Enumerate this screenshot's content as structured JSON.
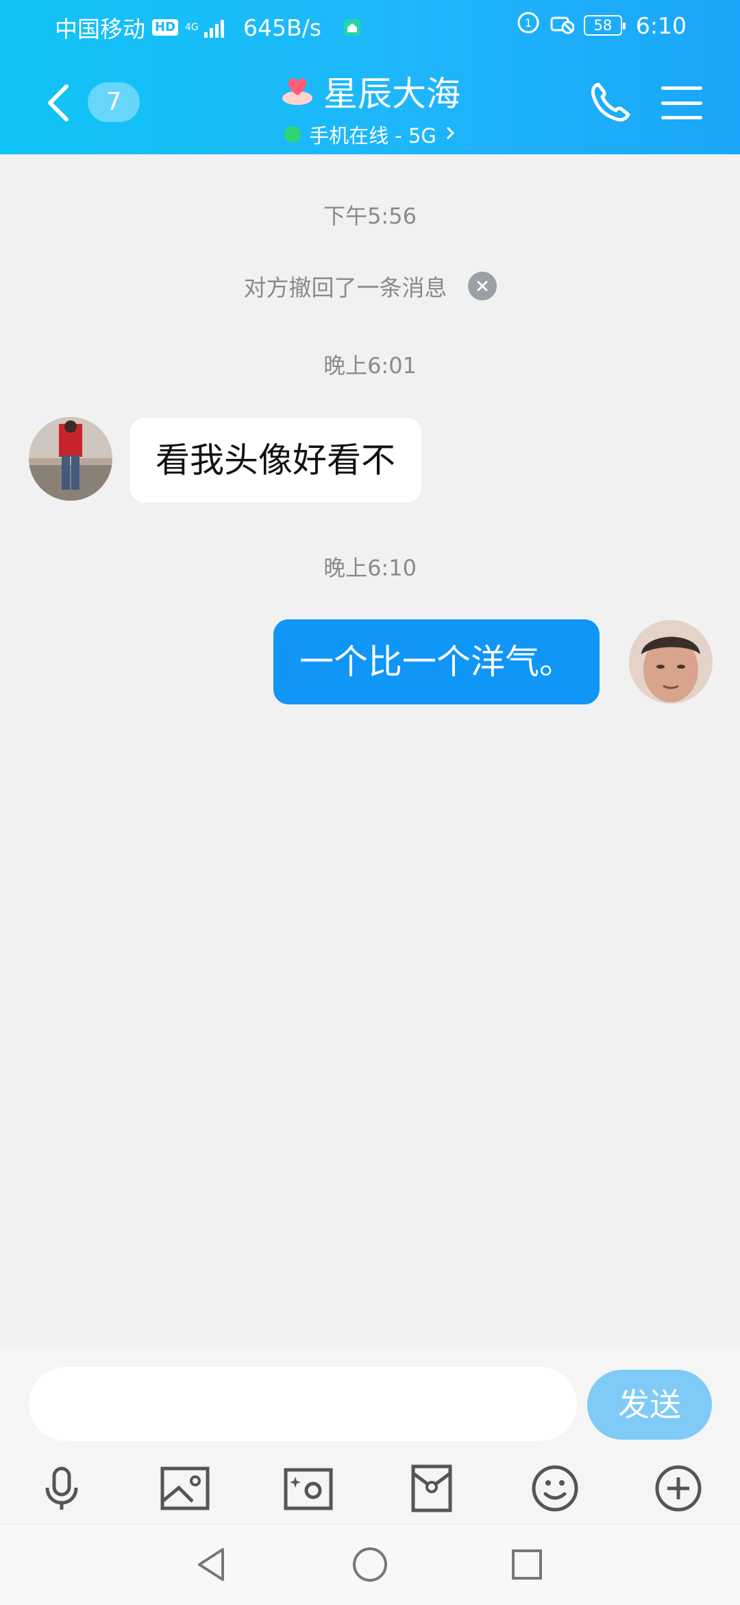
{
  "status_bar": {
    "carrier": "中国移动",
    "hd": "HD",
    "network": "4G",
    "net_speed": "645B/s",
    "battery": "58",
    "time": "6:10"
  },
  "header": {
    "unread_count": "7",
    "title": "星辰大海",
    "subtitle": "手机在线 - 5G",
    "accent": "#1fb6fb"
  },
  "chat": {
    "messages": [
      {
        "type": "timestamp",
        "text": "下午5:56"
      },
      {
        "type": "system",
        "text": "对方撤回了一条消息"
      },
      {
        "type": "timestamp",
        "text": "晚上6:01"
      },
      {
        "type": "incoming",
        "text": "看我头像好看不"
      },
      {
        "type": "timestamp",
        "text": "晚上6:10"
      },
      {
        "type": "outgoing",
        "text": "一个比一个洋气。"
      }
    ],
    "outgoing_bubble_color": "#0f96f6"
  },
  "composer": {
    "input_value": "",
    "input_placeholder": "",
    "send_label": "发送"
  },
  "toolbar": {
    "items": [
      "microphone-icon",
      "image-icon",
      "camera-icon",
      "red-packet-icon",
      "emoji-icon",
      "plus-icon"
    ]
  },
  "navbar": {
    "items": [
      "back-triangle-icon",
      "home-circle-icon",
      "recents-square-icon"
    ]
  }
}
